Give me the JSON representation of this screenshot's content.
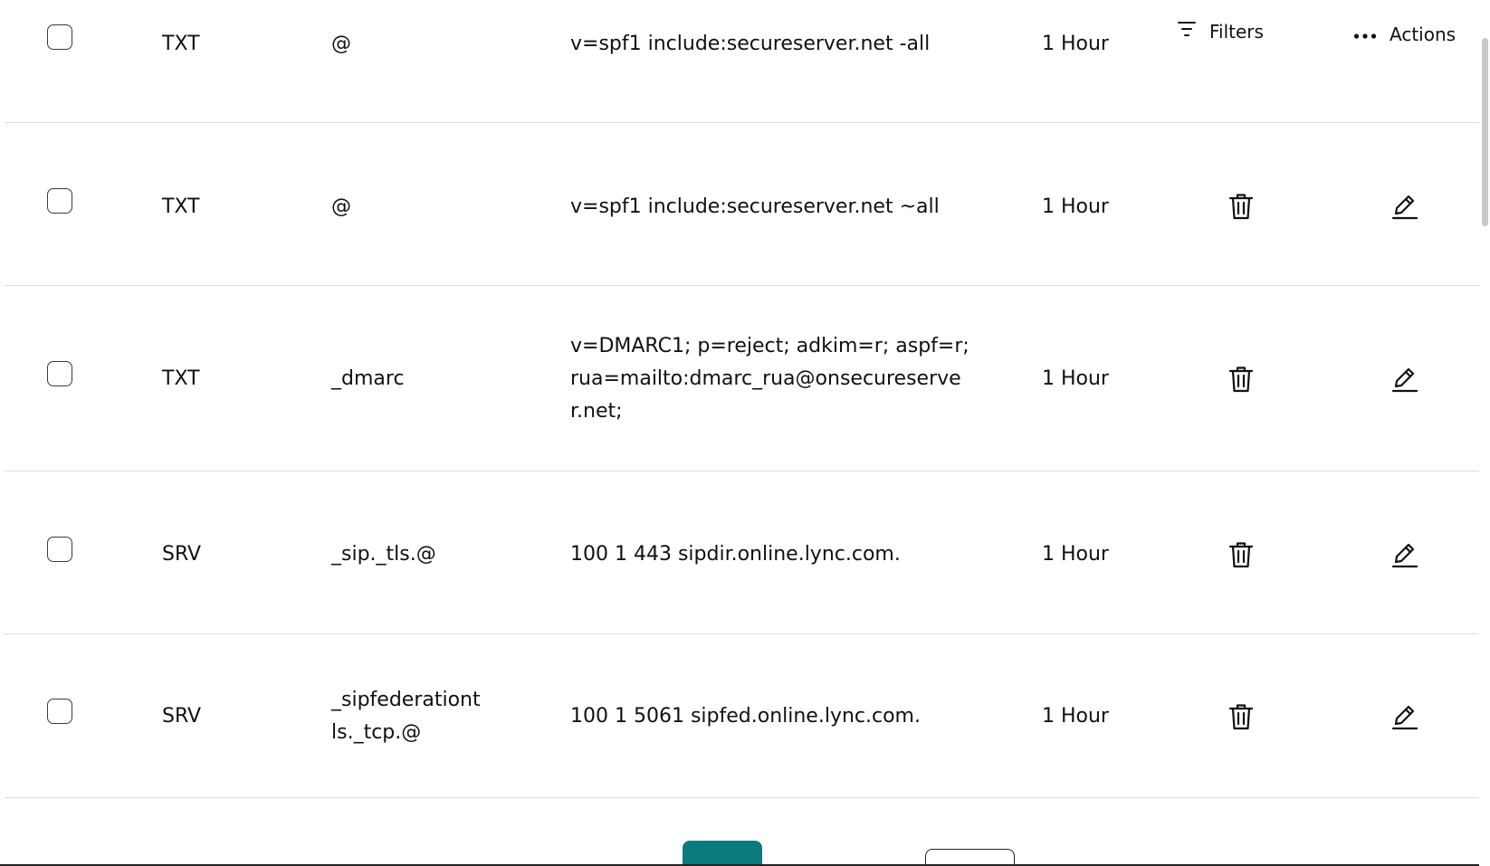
{
  "header": {
    "filters_label": "Filters",
    "actions_label": "Actions"
  },
  "records": [
    {
      "type": "TXT",
      "name": "@",
      "value": "v=spf1 include:secureserver.net -all",
      "ttl": "1 Hour"
    },
    {
      "type": "TXT",
      "name": "@",
      "value": "v=spf1 include:secureserver.net ~all",
      "ttl": "1 Hour"
    },
    {
      "type": "TXT",
      "name": "_dmarc",
      "value_lines": [
        "v=DMARC1; p=reject; adkim=r; aspf=r;",
        "rua=mailto:dmarc_rua@onsecureserve",
        "r.net;"
      ],
      "ttl": "1 Hour"
    },
    {
      "type": "SRV",
      "name": "_sip._tls.@",
      "value": "100 1 443 sipdir.online.lync.com.",
      "ttl": "1 Hour"
    },
    {
      "type": "SRV",
      "name_lines": [
        "_sipfederationt",
        "ls._tcp.@"
      ],
      "value": "100 1 5061 sipfed.online.lync.com.",
      "ttl": "1 Hour"
    }
  ],
  "icons": {
    "filter": "filter-icon",
    "more": "more-horizontal-icon",
    "delete": "trash-icon",
    "edit": "pencil-icon"
  },
  "colors": {
    "accent": "#0b7a7d",
    "divider": "#dcdcdc",
    "text": "#111111"
  }
}
